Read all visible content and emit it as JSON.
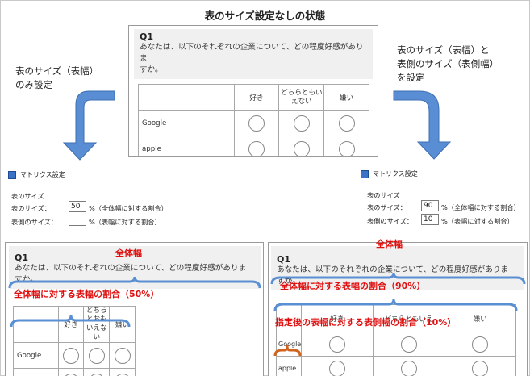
{
  "title": "表のサイズ設定なしの状態",
  "left_label": [
    "表のサイズ（表幅）",
    "のみ設定"
  ],
  "right_label": [
    "表のサイズ（表幅）と",
    "表側のサイズ（表側幅）",
    "を設定"
  ],
  "question": {
    "id": "Q1",
    "text_line1": "あなたは、以下のそれぞれの企業について、どの程度好感がありま",
    "text_line2": "すか。",
    "columns": [
      "好き",
      "どちらともいえない",
      "嫌い"
    ],
    "rows": [
      "Google",
      "apple"
    ]
  },
  "top_panel": {
    "col_line1": "どちらともい",
    "col_line2": "えない"
  },
  "left_panel": {
    "col_line1": "どちら",
    "col_line2": "とおも",
    "col_line3": "いえない"
  },
  "right_panel": {
    "col_label": "どちらともいえ"
  },
  "dialog": {
    "title": "マトリクス設定",
    "group": "表のサイズ",
    "table_size_label": "表のサイズ：",
    "side_size_label": "表側のサイズ：",
    "table_size_hint": "%（全体幅に対する割合）",
    "side_size_hint": "%（表幅に対する割合）"
  },
  "left_dialog": {
    "table_size": "50",
    "side_size": ""
  },
  "right_dialog": {
    "table_size": "90",
    "side_size": "10"
  },
  "annotations": {
    "left_full_width": "全体幅",
    "left_ratio": "全体幅に対する表幅の割合（50%）",
    "right_full_width": "全体幅",
    "right_ratio": "全体幅に対する表幅の割合（90%）",
    "right_side_ratio": "指定後の表幅に対する表側幅の割合（10%）"
  },
  "colors": {
    "annotation": "#e01010",
    "brace_blue": "#5b8fd3",
    "brace_orange": "#d0641e",
    "arrow": "#5a8ed4"
  }
}
